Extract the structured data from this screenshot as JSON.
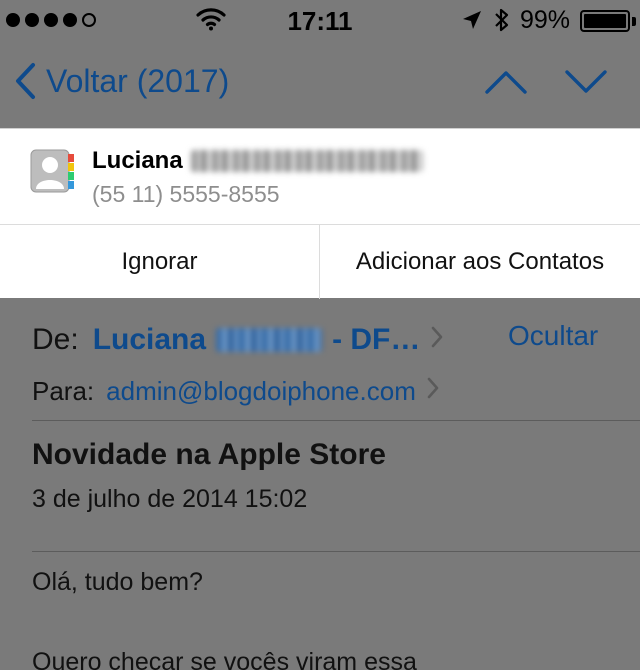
{
  "status_bar": {
    "signal_bars": 5,
    "signal_filled": 4,
    "time": "17:11",
    "battery_text": "99%",
    "battery_level": 0.99,
    "icons": [
      "wifi-icon",
      "location-arrow-icon",
      "bluetooth-icon",
      "battery-icon"
    ]
  },
  "nav": {
    "back_label": "Voltar (2017)",
    "icons": [
      "chevron-left-icon",
      "chevron-up-icon",
      "chevron-down-icon"
    ]
  },
  "contact_banner": {
    "name": "Luciana",
    "phone": "(55 11) 5555-8555",
    "ignore_label": "Ignorar",
    "add_label": "Adicionar aos Contatos",
    "icons": [
      "contacts-book-icon"
    ]
  },
  "mail": {
    "from_label": "De:",
    "from_name": "Luciana",
    "from_suffix": "- DF…",
    "hide_label": "Ocultar",
    "to_label": "Para:",
    "to_address": "admin@blogdoiphone.com",
    "subject": "Novidade na Apple Store",
    "date": "3 de julho de 2014 15:02",
    "body_line1": "Olá, tudo bem?",
    "body_line2": "Quero checar se vocês viram essa"
  },
  "colors": {
    "accent": "#0e4a8c",
    "dimmed_background": "#7a7a7a",
    "banner_background": "#ffffff",
    "secondary_text": "#8e8e8e"
  }
}
